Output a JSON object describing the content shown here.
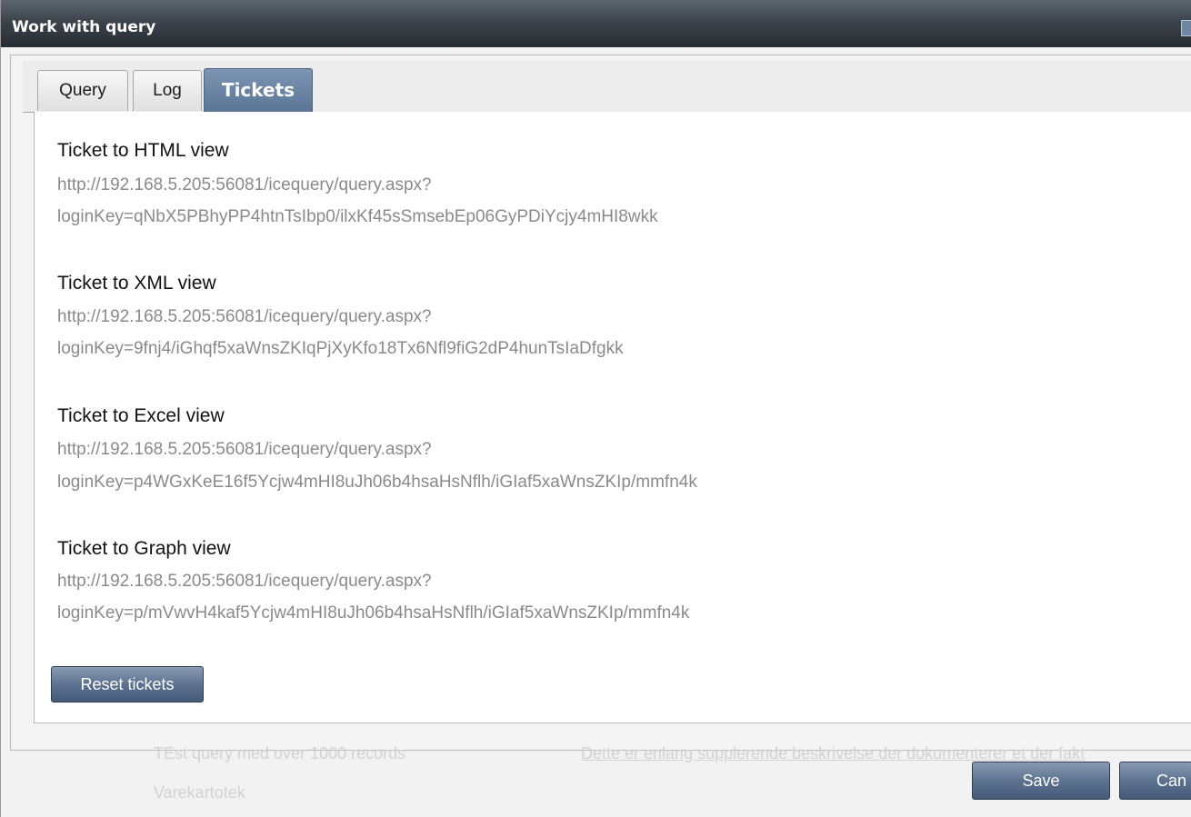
{
  "window": {
    "title": "Work with query"
  },
  "tabs": [
    {
      "label": "Query",
      "active": false
    },
    {
      "label": "Log",
      "active": false
    },
    {
      "label": "Tickets",
      "active": true
    }
  ],
  "tickets": [
    {
      "heading": "Ticket to HTML view",
      "url_line1": "http://192.168.5.205:56081/icequery/query.aspx?",
      "url_line2": "loginKey=qNbX5PBhyPP4htnTsIbp0/ilxKf45sSmsebEp06GyPDiYcjy4mHI8wkk"
    },
    {
      "heading": "Ticket to XML view",
      "url_line1": "http://192.168.5.205:56081/icequery/query.aspx?",
      "url_line2": "loginKey=9fnj4/iGhqf5xaWnsZKIqPjXyKfo18Tx6Nfl9fiG2dP4hunTsIaDfgkk"
    },
    {
      "heading": "Ticket to Excel view",
      "url_line1": "http://192.168.5.205:56081/icequery/query.aspx?",
      "url_line2": "loginKey=p4WGxKeE16f5Ycjw4mHI8uJh06b4hsaHsNflh/iGIaf5xaWnsZKIp/mmfn4k"
    },
    {
      "heading": "Ticket to Graph view",
      "url_line1": "http://192.168.5.205:56081/icequery/query.aspx?",
      "url_line2": "loginKey=p/mVwvH4kaf5Ycjw4mHI8uJh06b4hsaHsNflh/iGIaf5xaWnsZKIp/mmfn4k"
    }
  ],
  "buttons": {
    "reset": "Reset tickets",
    "save": "Save",
    "cancel": "Can"
  },
  "background": {
    "query_name": "TEst query med over 1000 records",
    "query_desc": "Dette er enlang supplerende beskrivelse der dokumenterer et der fakt",
    "query_group": "Varekartotek"
  }
}
